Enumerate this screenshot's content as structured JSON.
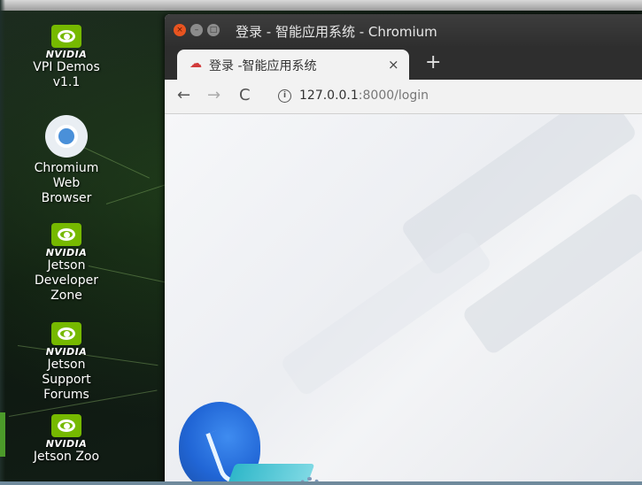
{
  "desktop": {
    "icons": [
      {
        "brand": "NVIDIA",
        "label": "VPI Demos v1.1",
        "lines": [
          "VPI Demos",
          "v1.1"
        ]
      },
      {
        "brand": "",
        "label": "Chromium Web Browser",
        "lines": [
          "Chromium",
          "Web",
          "Browser"
        ]
      },
      {
        "brand": "NVIDIA",
        "label": "Jetson Developer Zone",
        "lines": [
          "Jetson",
          "Developer",
          "Zone"
        ]
      },
      {
        "brand": "NVIDIA",
        "label": "Jetson Support Forums",
        "lines": [
          "Jetson",
          "Support",
          "Forums"
        ]
      },
      {
        "brand": "NVIDIA",
        "label": "Jetson Zoo",
        "lines": [
          "Jetson Zoo"
        ]
      }
    ]
  },
  "window": {
    "title": "登录 - 智能应用系统 - Chromium",
    "controls": {
      "close": "×",
      "minimize": "–",
      "maximize": "□"
    }
  },
  "tabs": [
    {
      "title": "登录 -智能应用系统",
      "close": "×",
      "active": true
    }
  ],
  "new_tab_label": "+",
  "toolbar": {
    "back": "←",
    "forward": "→",
    "reload": "C",
    "info": "i",
    "url_host": "127.0.0.1",
    "url_rest": ":8000/login"
  },
  "colors": {
    "accent_close": "#e95420",
    "nvidia_green": "#76b900",
    "tab_icon": "#d23b3b",
    "blob_blue": "#2166d6"
  },
  "icons": {
    "tab_favicon": "cloud-icon",
    "nvidia": "nvidia-eye-icon",
    "chromium": "chromium-logo-icon"
  }
}
